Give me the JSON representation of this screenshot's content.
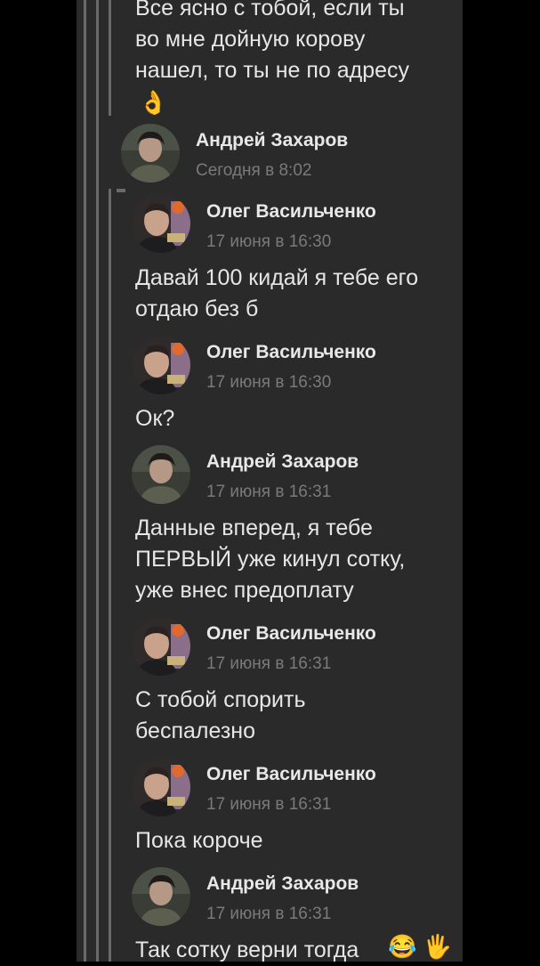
{
  "messages": [
    {
      "lines": [
        "Все ясно с тобой, если ты",
        "во мне дойную корову",
        "нашел, то ты не по адресу"
      ],
      "emoji": "👌"
    },
    {
      "author": "Андрей Захаров",
      "time": "Сегодня в 8:02"
    },
    {
      "author": "Олег Васильченко",
      "time": "17 июня в 16:30",
      "lines": [
        "Давай 100 кидай я тебе его",
        "отдаю без б"
      ]
    },
    {
      "author": "Олег Васильченко",
      "time": "17 июня в 16:30",
      "lines": [
        "Ок?"
      ]
    },
    {
      "author": "Андрей Захаров",
      "time": "17 июня в 16:31",
      "lines": [
        "Данные вперед, я тебе",
        "ПЕРВЫЙ уже кинул сотку,",
        "уже внес предоплату"
      ]
    },
    {
      "author": "Олег Васильченко",
      "time": "17 июня в 16:31",
      "lines": [
        "С тобой спорить",
        "беспалезно"
      ]
    },
    {
      "author": "Олег Васильченко",
      "time": "17 июня в 16:31",
      "lines": [
        "Пока короче"
      ]
    },
    {
      "author": "Андрей Захаров",
      "time": "17 июня в 16:31",
      "lines": [
        "Так сотку верни тогда"
      ],
      "emoji": "😂 🖐"
    }
  ],
  "colors": {
    "background": "#2a2a2a",
    "name": "#e8e8e8",
    "time": "#7a7a7a",
    "rule": "#6a6a6a"
  }
}
